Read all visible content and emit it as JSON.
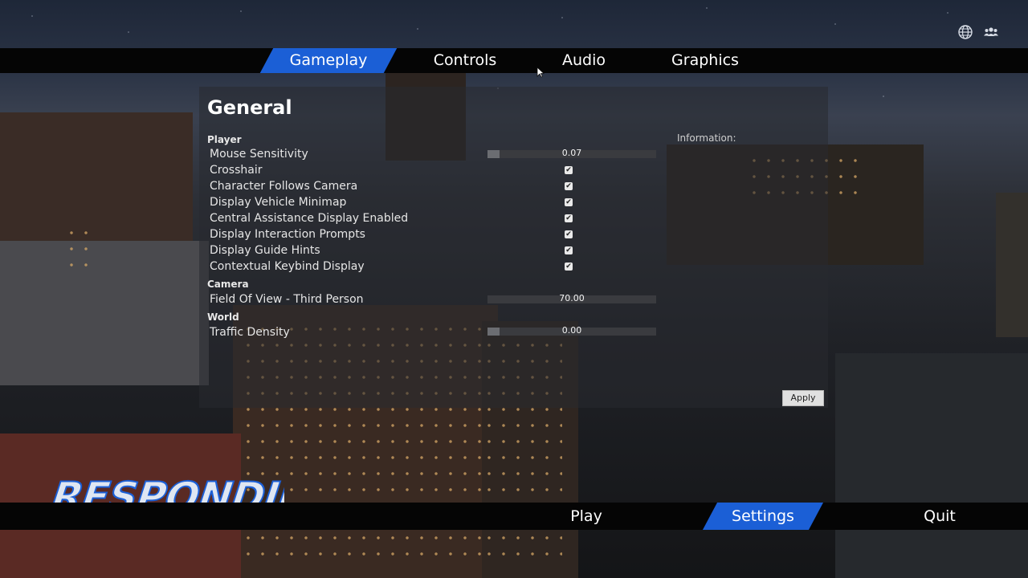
{
  "top_tabs": [
    {
      "label": "Gameplay",
      "active": true
    },
    {
      "label": "Controls",
      "active": false
    },
    {
      "label": "Audio",
      "active": false
    },
    {
      "label": "Graphics",
      "active": false
    }
  ],
  "top_icons": [
    "globe-icon",
    "users-icon"
  ],
  "panel": {
    "title": "General",
    "info_label": "Information:",
    "apply_label": "Apply",
    "sections": [
      {
        "name": "Player"
      },
      {
        "name": "Camera"
      },
      {
        "name": "World"
      }
    ],
    "player": {
      "mouse_sensitivity": {
        "label": "Mouse Sensitivity",
        "value_text": "0.07",
        "fill_fraction": 0.07
      },
      "crosshair": {
        "label": "Crosshair",
        "checked": true
      },
      "character_follows_camera": {
        "label": "Character Follows Camera",
        "checked": true
      },
      "display_vehicle_minimap": {
        "label": "Display Vehicle Minimap",
        "checked": true
      },
      "central_assistance": {
        "label": "Central Assistance Display Enabled",
        "checked": true
      },
      "interaction_prompts": {
        "label": "Display Interaction Prompts",
        "checked": true
      },
      "guide_hints": {
        "label": "Display Guide Hints",
        "checked": true
      },
      "contextual_keybind": {
        "label": "Contextual Keybind Display",
        "checked": true
      }
    },
    "camera": {
      "fov_third_person": {
        "label": "Field Of View - Third Person",
        "value_text": "70.00",
        "fill_fraction": 0.0
      }
    },
    "world": {
      "traffic_density": {
        "label": "Traffic Density",
        "value_text": "0.00",
        "fill_fraction": 0.07
      }
    }
  },
  "bottom_tabs": [
    {
      "label": "Play",
      "active": false
    },
    {
      "label": "Settings",
      "active": true
    },
    {
      "label": "Quit",
      "active": false
    }
  ],
  "logo_text": "RESPONDING",
  "colors": {
    "accent": "#1b5fd6",
    "bar_bg": "#050505"
  }
}
